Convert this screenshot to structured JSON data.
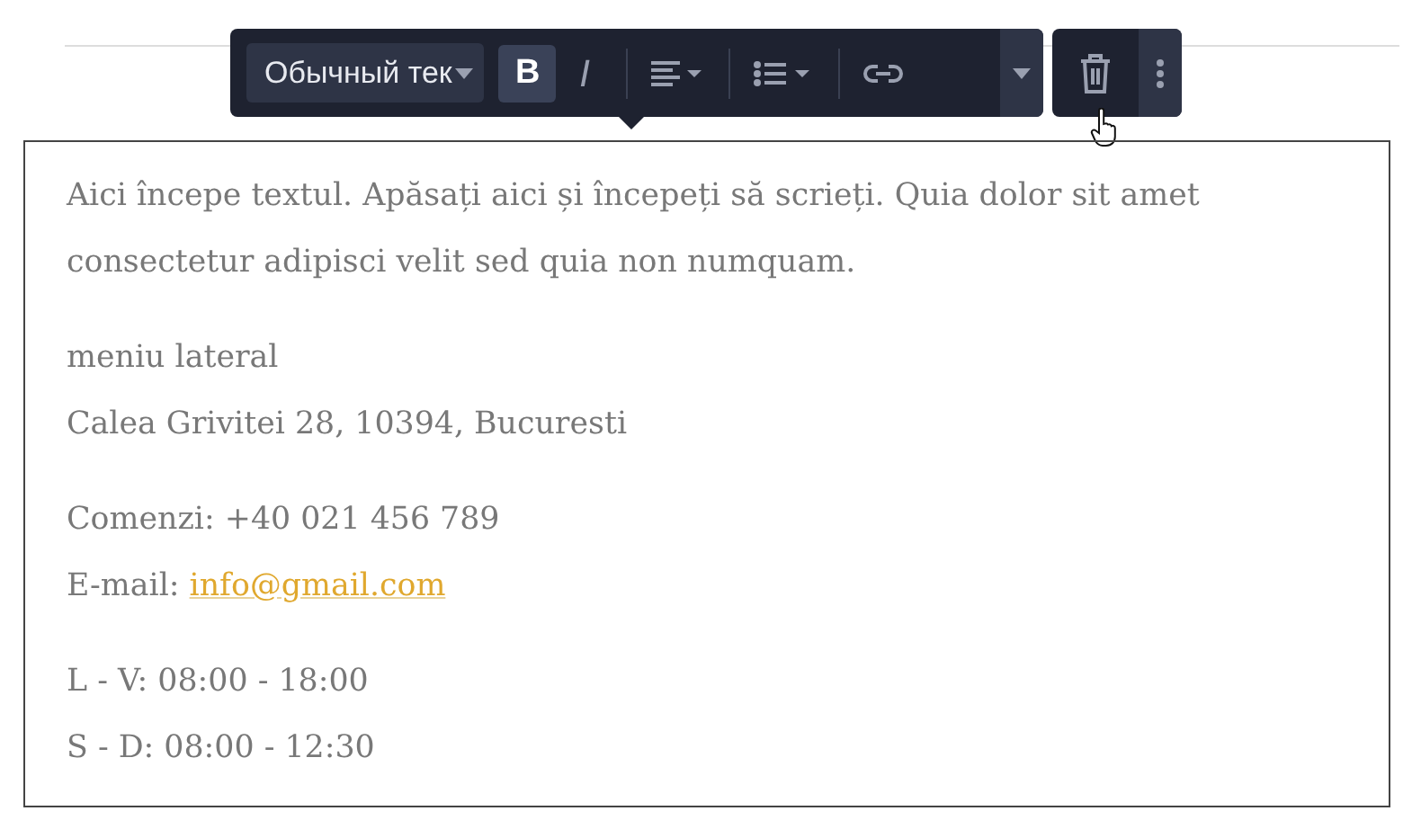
{
  "toolbar": {
    "style_dropdown": {
      "value": "Обычный тек"
    },
    "buttons": [
      {
        "kind": "bold",
        "label": "B",
        "selected": true
      },
      {
        "kind": "italic",
        "label": "I",
        "selected": false
      },
      {
        "kind": "align"
      },
      {
        "kind": "list"
      },
      {
        "kind": "link"
      },
      {
        "kind": "expand"
      }
    ],
    "side_buttons": [
      {
        "kind": "delete"
      },
      {
        "kind": "more"
      }
    ]
  },
  "editor": {
    "paragraphs": [
      {
        "lines": [
          {
            "text": "Aici începe textul. Apăsați aici și începeți să scrieți. Quia dolor sit amet consectetur adipisci velit sed quia non numquam."
          }
        ]
      },
      {
        "lines": [
          {
            "text": "meniu lateral"
          },
          {
            "text": "Calea Grivitei 28, 10394, Bucuresti"
          }
        ]
      },
      {
        "lines": [
          {
            "text": "Comenzi: +40 021 456 789"
          },
          {
            "text": "E-mail:",
            "link": "info@gmail.com"
          }
        ]
      },
      {
        "lines": [
          {
            "text": "L - V: 08:00 - 18:00"
          },
          {
            "text": "S - D: 08:00 - 12:30"
          }
        ]
      }
    ]
  }
}
